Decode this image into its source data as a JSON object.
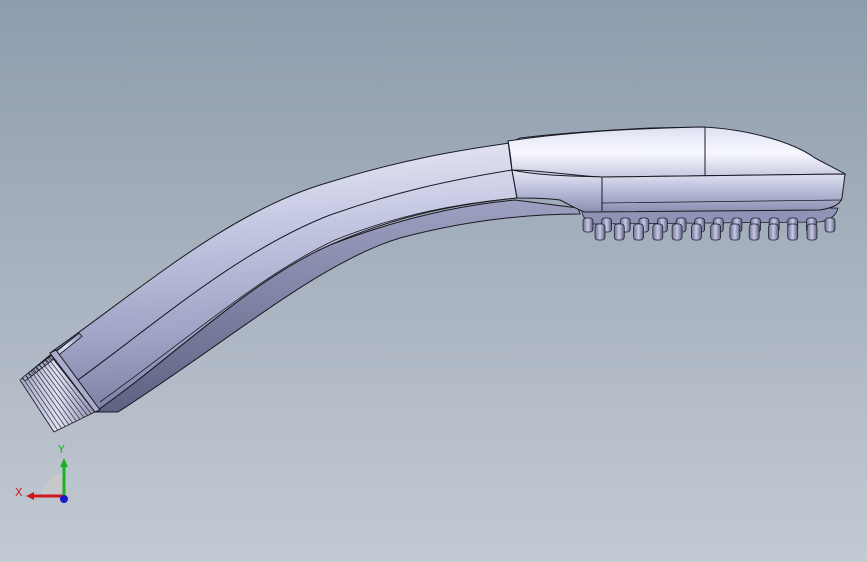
{
  "viewport": {
    "background_top": "#8e9cad",
    "background_bottom": "#c3cad3"
  },
  "model": {
    "body_color": "#c9cde6",
    "edge_color": "#1a1a22"
  },
  "triad": {
    "x_label": "X",
    "y_label": "Y",
    "x_color": "#cc1a1a",
    "y_color": "#1ab31a",
    "z_color": "#1a1acc"
  }
}
